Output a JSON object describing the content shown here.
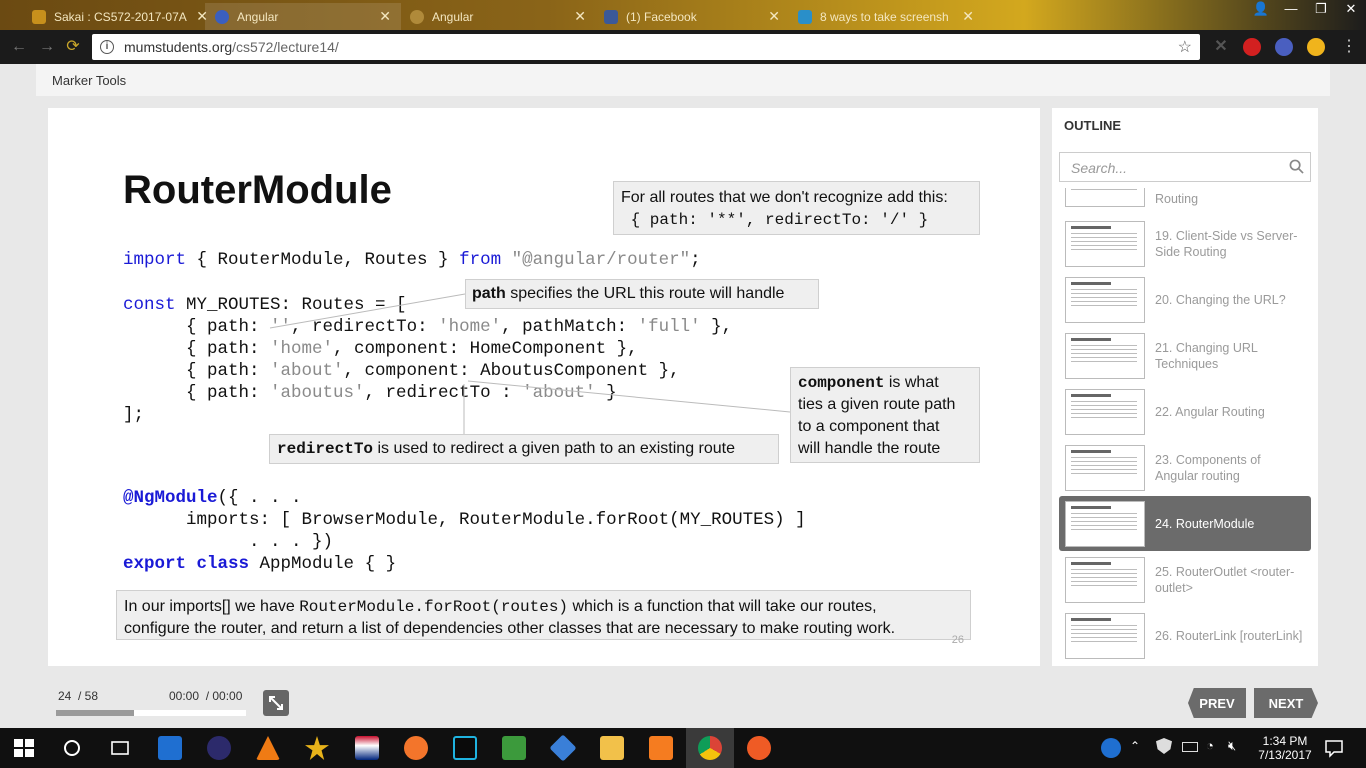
{
  "browser": {
    "tabs": [
      {
        "title": "Sakai : CS572-2017-07A",
        "favicon_color": "#c7901c"
      },
      {
        "title": "Angular",
        "favicon_color": "#3a5fbf"
      },
      {
        "title": "Angular",
        "favicon_color": "#b08a3a"
      },
      {
        "title": "(1) Facebook",
        "favicon_color": "#3b5998"
      },
      {
        "title": "8 ways to take screensh",
        "favicon_color": "#2a8fc9"
      }
    ],
    "active_tab": 1,
    "url_host": "mumstudents.org",
    "url_path": "/cs572/lecture14/",
    "window_buttons": {
      "user": "👤",
      "minimize": "—",
      "restore": "❐",
      "close": "✕"
    }
  },
  "header": {
    "title": "Marker Tools"
  },
  "slide": {
    "title": "RouterModule",
    "code_import": {
      "kw1": "import",
      "mid": " { RouterModule, Routes } ",
      "kw2": "from",
      "str": " \"@angular/router\"",
      "end": ";"
    },
    "code_routes": {
      "l1_kw": "const",
      "l1": " MY_ROUTES: Routes = [",
      "l2a": "      { path: ",
      "l2s": "''",
      "l2b": ", redirectTo: ",
      "l2s2": "'home'",
      "l2c": ", pathMatch: ",
      "l2s3": "'full'",
      "l2d": " },",
      "l3a": "      { path: ",
      "l3s": "'home'",
      "l3b": ", component: HomeComponent },",
      "l4a": "      { path: ",
      "l4s": "'about'",
      "l4b": ", component: AboutusComponent },",
      "l5a": "      { path: ",
      "l5s": "'aboutus'",
      "l5b": ", redirectTo : ",
      "l5s2": "'about'",
      "l5c": " }",
      "l6": "];"
    },
    "code_module": {
      "l1_kw": "@NgModule",
      "l1": "({ . . .",
      "l2": "      imports: [ BrowserModule, RouterModule.forRoot(MY_ROUTES) ]",
      "l3": "            . . . })",
      "l4_kw1": "export",
      "l4_kw2": "class",
      "l4": " AppModule { }"
    },
    "callout_wildcard": {
      "line1": "For all routes that we don't recognize add this:",
      "line2": " { path: '**', redirectTo: '/' }"
    },
    "callout_path": {
      "term": "path",
      "text": " specifies the URL this route will handle"
    },
    "callout_component": {
      "term": "component",
      "text1": " is what",
      "text2": "ties a given route path",
      "text3": "to a component that",
      "text4": "will handle the route"
    },
    "callout_redirect": {
      "term": "redirectTo",
      "text": " is used to redirect a given path to an existing route"
    },
    "summary": {
      "pre": "In our imports[] we have ",
      "mono": "RouterModule.forRoot(routes)",
      "post": " which is a function that will take our routes,",
      "line2": "configure the router, and return a list of dependencies other classes that are necessary to make routing work."
    },
    "page_number": "26"
  },
  "outline": {
    "title": "OUTLINE",
    "search_placeholder": "Search...",
    "items": [
      {
        "label": "19. Client-Side vs Server-Side Routing"
      },
      {
        "label": "20. Changing the URL?"
      },
      {
        "label": "21. Changing URL Techniques"
      },
      {
        "label": "22. Angular Routing"
      },
      {
        "label": "23. Components of Angular routing"
      },
      {
        "label": "24. RouterModule",
        "current": true
      },
      {
        "label": "25. RouterOutlet <router-outlet>"
      },
      {
        "label": "26. RouterLink [routerLink]"
      }
    ],
    "partial_top_label": "Routing"
  },
  "player": {
    "slide_counter": "24  / 58",
    "time": "00:00  / 00:00",
    "progress": 0.41,
    "prev_label": "PREV",
    "next_label": "NEXT"
  },
  "taskbar": {
    "time": "1:34 PM",
    "date": "7/13/2017",
    "apps": [
      {
        "name": "start-icon"
      },
      {
        "name": "cortana-icon"
      },
      {
        "name": "task-view-icon"
      },
      {
        "name": "dropbox-icon"
      },
      {
        "name": "eclipse-icon"
      },
      {
        "name": "vlc-icon"
      },
      {
        "name": "star-app-icon"
      },
      {
        "name": "flag-app-icon"
      },
      {
        "name": "firefox-icon"
      },
      {
        "name": "webstorm-icon"
      },
      {
        "name": "spreadsheet-icon"
      },
      {
        "name": "git-icon"
      },
      {
        "name": "file-explorer-icon"
      },
      {
        "name": "xampp-icon"
      },
      {
        "name": "chrome-icon"
      },
      {
        "name": "postman-icon"
      }
    ]
  }
}
